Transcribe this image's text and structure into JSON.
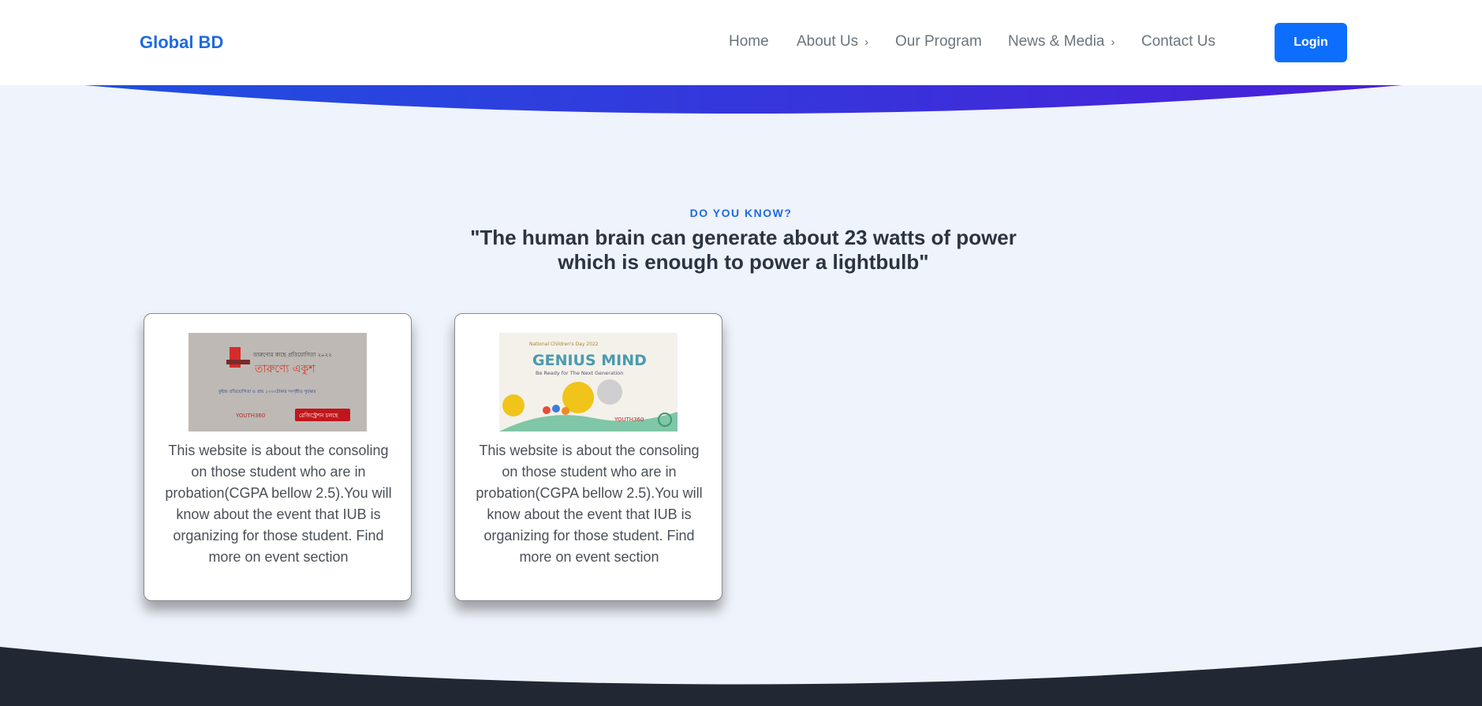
{
  "nav": {
    "brand": "Global BD",
    "items": [
      {
        "label": "Home",
        "has_submenu": false
      },
      {
        "label": "About Us",
        "has_submenu": true
      },
      {
        "label": "Our Program",
        "has_submenu": false
      },
      {
        "label": "News & Media",
        "has_submenu": true
      },
      {
        "label": "Contact Us",
        "has_submenu": false
      }
    ],
    "login_label": "Login"
  },
  "hero": {
    "eyebrow": "DO YOU KNOW?",
    "quote": "\"The human brain can generate about 23 watts of power which is enough to power a lightbulb\""
  },
  "cards": [
    {
      "image_alt": "Tarunno Ekush event banner",
      "image_text": {
        "title": "তারুণ্যে একুশ",
        "subtitle": "তারুণ্যের কাছে প্রতিযোগিতা ২০২২",
        "line": "কুইজ প্রতিযোগিতা ও প্রায় ১০০০টাকার সংগৃহীত পুরস্কার",
        "button": "রেজিস্ট্রেশন চলছে",
        "logo": "YOUTH360"
      },
      "text": "This website is about the consoling on those student who are in probation(CGPA bellow 2.5).You will know about the event that IUB is organizing for those student. Find more on event section"
    },
    {
      "image_alt": "Genius Mind event banner",
      "image_text": {
        "top": "National Children's Day 2022",
        "title": "GENIUS MIND",
        "subtitle": "Be Ready for The Next Generation",
        "logo": "YOUTH360"
      },
      "text": "This website is about the consoling on those student who are in probation(CGPA bellow 2.5).You will know about the event that IUB is organizing for those student. Find more on event section"
    }
  ],
  "colors": {
    "brand": "#1f6ae0",
    "primary_button": "#0d6efd",
    "wave_start": "#1f4fe0",
    "wave_end": "#4a1fd8",
    "footer": "#212834",
    "section_bg": "#eff3fb"
  }
}
